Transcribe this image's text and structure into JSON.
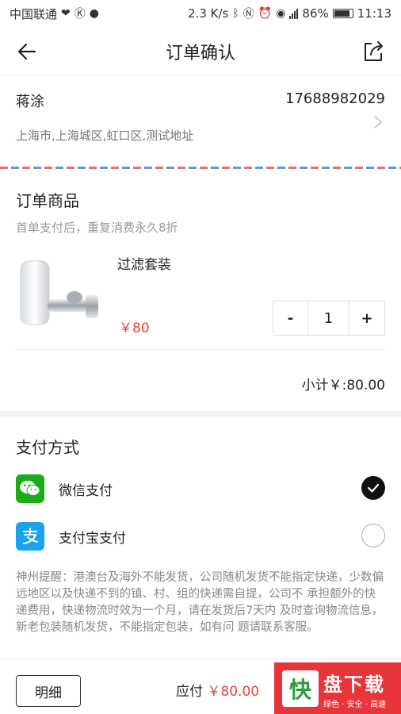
{
  "status_bar": {
    "carrier": "中国联通",
    "speed": "2.3 K/s",
    "battery": "86%",
    "time": "11:13"
  },
  "nav": {
    "title": "订单确认"
  },
  "address": {
    "name": "蒋涂",
    "phone": "17688982029",
    "detail": "上海市,上海城区,虹口区,测试地址"
  },
  "goods": {
    "section_title": "订单商品",
    "promo": "首单支付后，重复消费永久8折",
    "product": {
      "name": "过滤套装",
      "price": "￥80",
      "quantity": "1"
    },
    "stepper": {
      "minus": "-",
      "plus": "+"
    },
    "subtotal": "小计￥:80.00"
  },
  "payment": {
    "section_title": "支付方式",
    "options": [
      {
        "label": "微信支付",
        "selected": true
      },
      {
        "label": "支付宝支付",
        "selected": false
      }
    ],
    "notice": "神州提醒：港澳台及海外不能发货，公司随机发货不能指定快递，少数偏远地区以及快递不到的镇、村、组的快递需自提，公司不 承担额外的快递费用，快递物流时效为一个月，请在发货后7天内 及时查询物流信息，新老包装随机发货，不能指定包装，如有问 题请联系客服。"
  },
  "bottom": {
    "detail_button": "明细",
    "due_label": "应付",
    "due_amount": "￥80.00"
  },
  "watermark": {
    "brand": "快",
    "title": "盘下载",
    "slogan": "绿色 · 安全 · 高速"
  },
  "colors": {
    "price_red": "#e8453c",
    "wechat_green": "#1aad19",
    "alipay_blue": "#1aa3e8"
  }
}
